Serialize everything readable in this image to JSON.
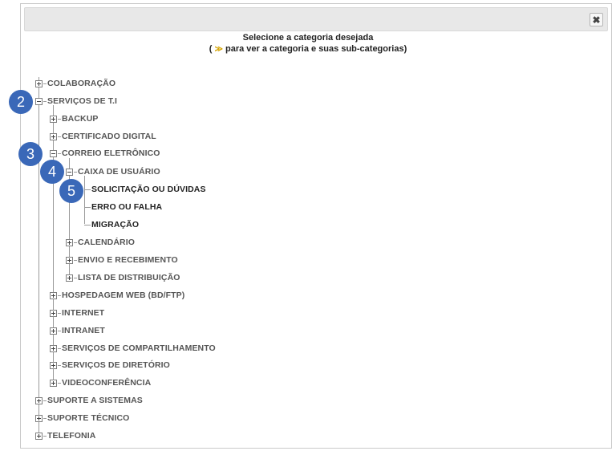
{
  "dialog": {
    "close_label": "✖",
    "heading_line1": "Selecione a categoria desejada",
    "heading_prefix": "(",
    "heading_arrow": "≫",
    "heading_line2": "para ver a categoria e suas sub-categorias)"
  },
  "tree": [
    {
      "label": "COLABORAÇÃO",
      "icon": "plus"
    },
    {
      "label": "SERVIÇOS DE T.I",
      "icon": "minus"
    },
    {
      "label": "BACKUP",
      "icon": "plus"
    },
    {
      "label": "CERTIFICADO DIGITAL",
      "icon": "plus"
    },
    {
      "label": "CORREIO ELETRÔNICO",
      "icon": "minus"
    },
    {
      "label": "CAIXA DE USUÁRIO",
      "icon": "minus"
    },
    {
      "label": "SOLICITAÇÃO OU DÚVIDAS",
      "icon": "leaf"
    },
    {
      "label": "ERRO OU FALHA",
      "icon": "leaf"
    },
    {
      "label": "MIGRAÇÃO",
      "icon": "leaf"
    },
    {
      "label": "CALENDÁRIO",
      "icon": "plus"
    },
    {
      "label": "ENVIO E RECEBIMENTO",
      "icon": "plus"
    },
    {
      "label": "LISTA DE DISTRIBUIÇÃO",
      "icon": "plus"
    },
    {
      "label": "HOSPEDAGEM WEB (BD/FTP)",
      "icon": "plus"
    },
    {
      "label": "INTERNET",
      "icon": "plus"
    },
    {
      "label": "INTRANET",
      "icon": "plus"
    },
    {
      "label": "SERVIÇOS DE COMPARTILHAMENTO",
      "icon": "plus"
    },
    {
      "label": "SERVIÇOS DE DIRETÓRIO",
      "icon": "plus"
    },
    {
      "label": "VIDEOCONFERÊNCIA",
      "icon": "plus"
    },
    {
      "label": "SUPORTE A SISTEMAS",
      "icon": "plus"
    },
    {
      "label": "SUPORTE TÉCNICO",
      "icon": "plus"
    },
    {
      "label": "TELEFONIA",
      "icon": "plus"
    }
  ],
  "badges": [
    "2",
    "3",
    "4",
    "5"
  ],
  "colors": {
    "badge": "#3a68b8",
    "line": "#9a9a9a"
  }
}
